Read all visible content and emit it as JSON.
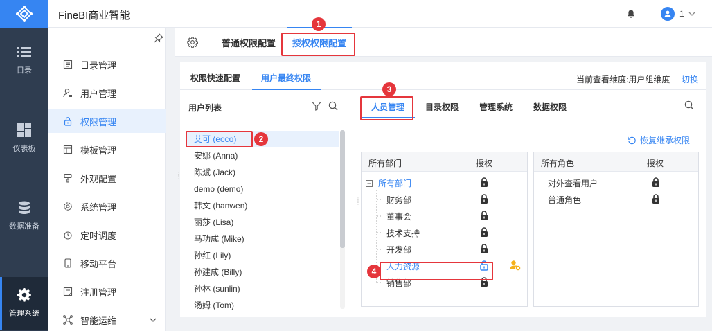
{
  "app": {
    "title": "FineBI商业智能"
  },
  "header": {
    "user_name": "1"
  },
  "rail": {
    "items": [
      {
        "label": "目录",
        "icon": "list-icon"
      },
      {
        "label": "仪表板",
        "icon": "dashboard-icon"
      },
      {
        "label": "数据准备",
        "icon": "database-icon"
      },
      {
        "label": "管理系统",
        "icon": "gear-icon"
      }
    ]
  },
  "submenu": {
    "items": [
      {
        "label": "目录管理"
      },
      {
        "label": "用户管理"
      },
      {
        "label": "权限管理"
      },
      {
        "label": "模板管理"
      },
      {
        "label": "外观配置"
      },
      {
        "label": "系统管理"
      },
      {
        "label": "定时调度"
      },
      {
        "label": "移动平台"
      },
      {
        "label": "注册管理"
      },
      {
        "label": "智能运维"
      }
    ]
  },
  "tabs_top": {
    "general": "普通权限配置",
    "grant": "授权权限配置"
  },
  "tabs_second": {
    "quick": "权限快速配置",
    "final": "用户最终权限"
  },
  "dimension": {
    "label": "当前查看维度:用户组维度",
    "switch": "切换"
  },
  "user_list": {
    "title": "用户列表",
    "users": [
      "艾可 (eoco)",
      "安娜 (Anna)",
      "陈斌 (Jack)",
      "demo (demo)",
      "韩文 (hanwen)",
      "丽莎 (Lisa)",
      "马功成 (Mike)",
      "孙红 (Lily)",
      "孙建成 (Billy)",
      "孙林 (sunlin)",
      "汤姆 (Tom)"
    ]
  },
  "perm_tabs": {
    "people": "人员管理",
    "catalog": "目录权限",
    "admin": "管理系统",
    "data": "数据权限"
  },
  "restore": {
    "label": "恢复继承权限"
  },
  "dept_box": {
    "head_col1": "所有部门",
    "head_col2": "授权",
    "rows": [
      "所有部门",
      "财务部",
      "董事会",
      "技术支持",
      "开发部",
      "人力资源",
      "销售部"
    ]
  },
  "role_box": {
    "head_col1": "所有角色",
    "head_col2": "授权",
    "rows": [
      "对外查看用户",
      "普通角色"
    ]
  },
  "callouts": [
    "1",
    "2",
    "3",
    "4"
  ],
  "colors": {
    "accent": "#3685f2",
    "rail": "#2f3d50",
    "callout": "#e5363c"
  }
}
